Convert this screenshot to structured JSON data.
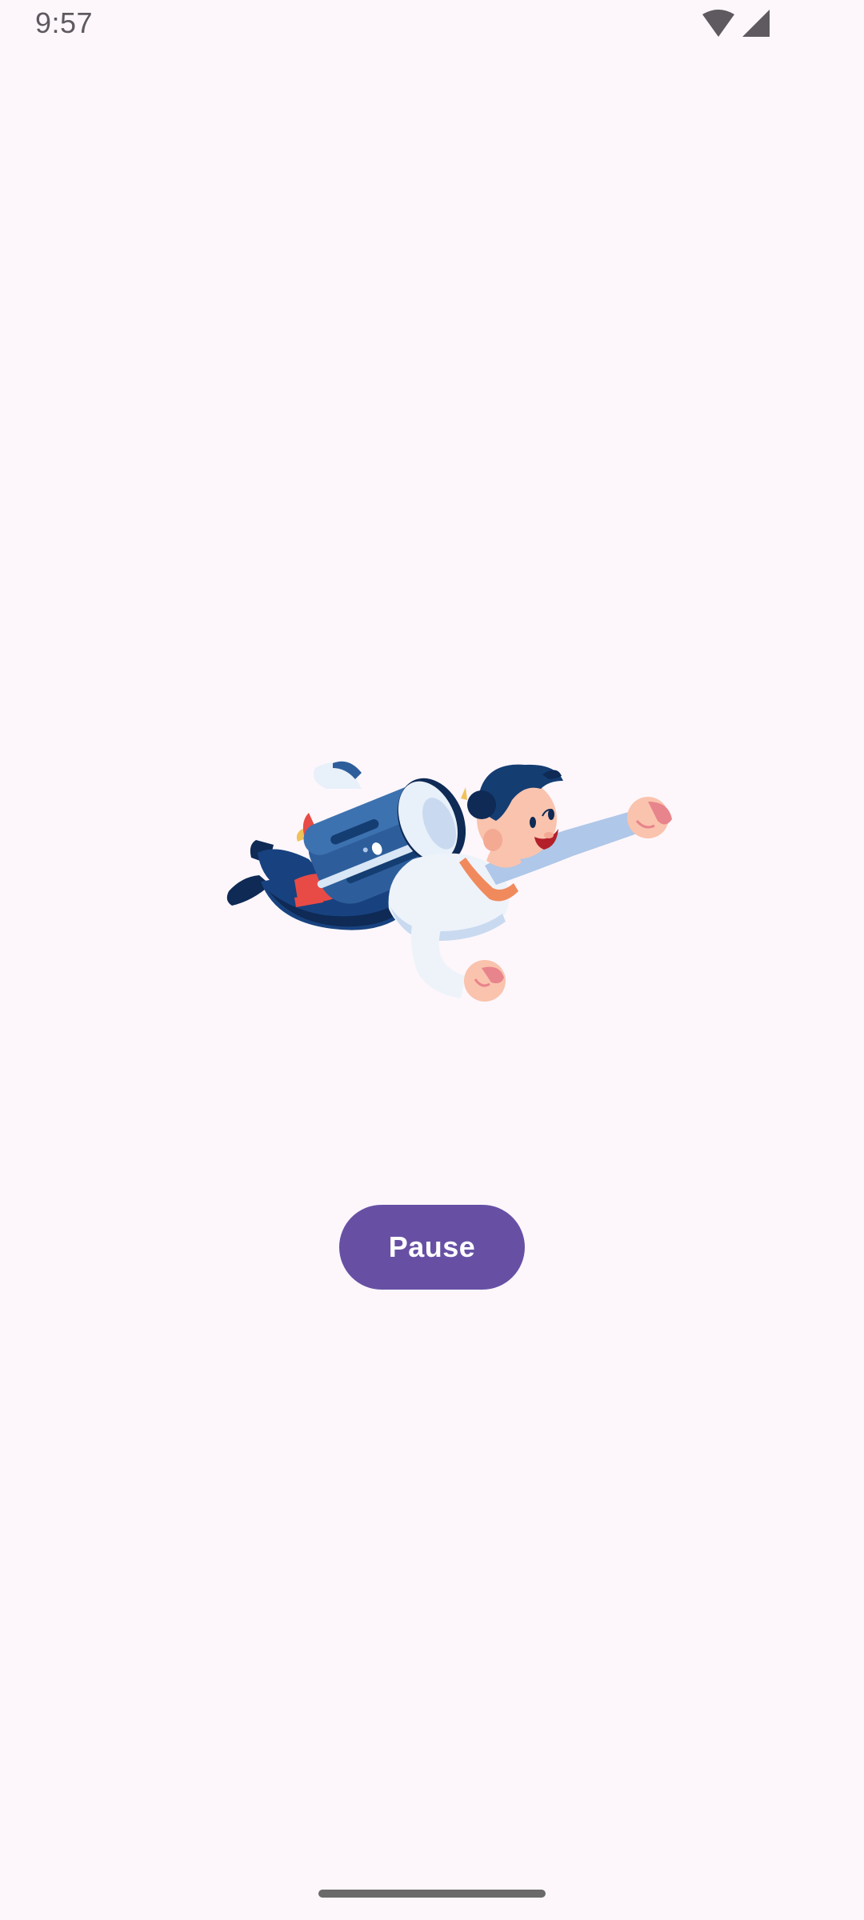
{
  "status_bar": {
    "time": "9:57",
    "icons": [
      "wifi-icon",
      "cellular-signal-icon"
    ]
  },
  "illustration": {
    "subject": "jetpack-flying-person-illustration"
  },
  "controls": {
    "pause_label": "Pause"
  },
  "colors": {
    "background": "#FDF7FC",
    "button": "#6750A4",
    "button_text": "#FFFFFF",
    "status_icon": "#5E5A60"
  }
}
